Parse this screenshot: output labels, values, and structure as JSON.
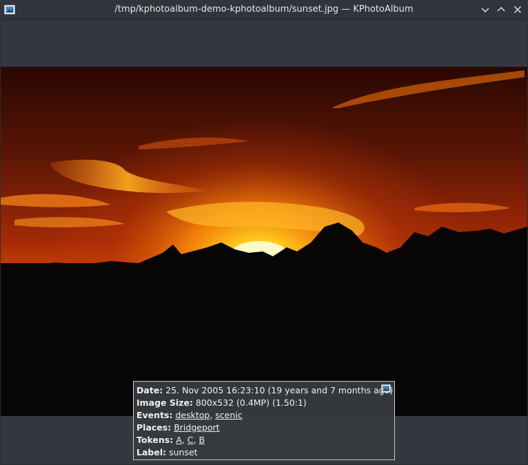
{
  "window": {
    "title": "/tmp/kphotoalbum-demo-kphotoalbum/sunset.jpg — KPhotoAlbum",
    "icons": [
      "kphotoalbum-app-icon",
      "chevron-down-icon",
      "chevron-up-icon",
      "close-icon"
    ]
  },
  "photo": {
    "subject": "sunset"
  },
  "info": {
    "date": {
      "label": "Date:",
      "value": "25. Nov 2005 16:23:10 (19 years and 7 months ago)"
    },
    "size": {
      "label": "Image Size:",
      "value": "800x532 (0.4MP) (1.50:1)"
    },
    "events": {
      "label": "Events:",
      "items": [
        "desktop",
        "scenic"
      ]
    },
    "places": {
      "label": "Places:",
      "items": [
        "Bridgeport"
      ]
    },
    "tokens": {
      "label": "Tokens:",
      "items": [
        "A",
        "C",
        "B"
      ]
    },
    "label": {
      "label": "Label:",
      "value": "sunset"
    },
    "sep": ", "
  }
}
